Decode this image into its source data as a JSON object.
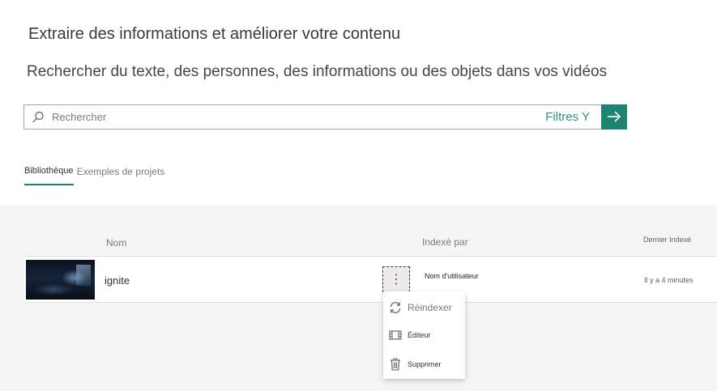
{
  "header": {
    "title": "Extraire des informations et améliorer votre contenu",
    "subtitle": "Rechercher du texte, des personnes, des informations ou des objets dans vos vidéos"
  },
  "search": {
    "placeholder": "Rechercher",
    "value": "",
    "filters_label": "Filtres Y",
    "icon": "search-icon",
    "go_icon": "arrow-right-icon"
  },
  "tabs": [
    {
      "label": "Bibliothèque",
      "active": true
    },
    {
      "label": "Exemples de projets",
      "active": false
    }
  ],
  "table": {
    "columns": [
      "Nom",
      "Indexé par",
      "Dernier Indexé"
    ],
    "rows": [
      {
        "name": "ignite",
        "indexed_by": "Nom d'utilisateur",
        "last_indexed": "Il y a 4 minutes"
      }
    ]
  },
  "context_menu": {
    "items": [
      {
        "label": "Réindexer",
        "icon": "refresh-icon"
      },
      {
        "label": "Éditeur",
        "icon": "film-icon"
      },
      {
        "label": "Supprimer",
        "icon": "trash-icon"
      }
    ]
  },
  "colors": {
    "accent": "#1c8471",
    "panel": "#f5f5f5"
  }
}
